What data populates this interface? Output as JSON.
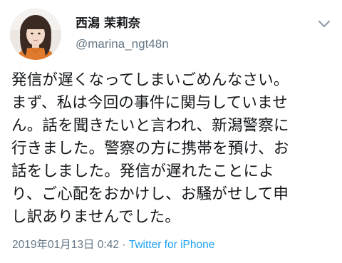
{
  "tweet": {
    "author": {
      "display_name": "西潟 茉莉奈",
      "handle": "@marina_ngt48n"
    },
    "menu_icon": "chevron-down-icon",
    "text_lines": [
      "発信が遅くなってしまいごめんなさい。",
      "まず、私は今回の事件に関与していませ",
      "ん。話を聞きたいと言われ、新潟警察に",
      "行きました。警察の方に携帯を預け、お",
      "話をしました。発信が遅れたことによ",
      "り、ご心配をおかけし、お騒がせして申",
      "し訳ありませんでした。"
    ],
    "timestamp": "2019年01月13日 0:42",
    "separator": "·",
    "source": "Twitter for iPhone"
  },
  "colors": {
    "text": "#14171a",
    "secondary": "#657786",
    "link": "#1da1f2",
    "background": "#ffffff"
  }
}
